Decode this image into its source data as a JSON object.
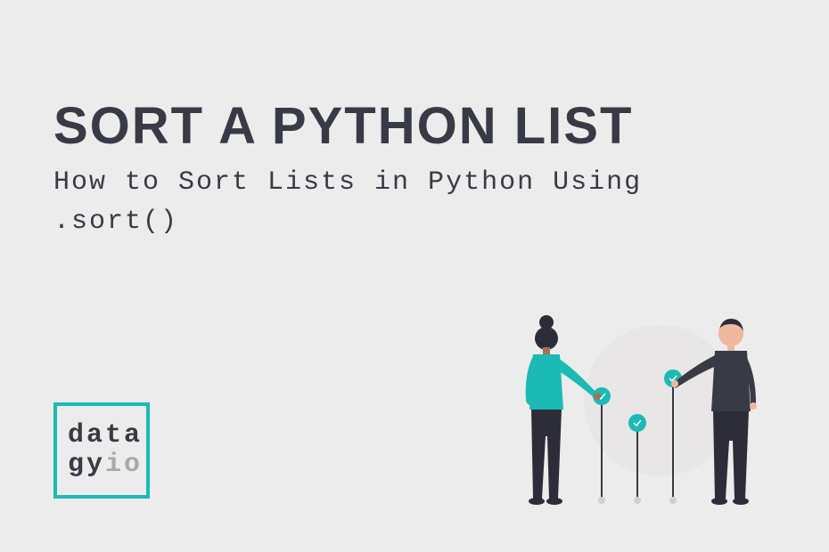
{
  "title": "SORT A PYTHON LIST",
  "subtitle": "How to Sort Lists in Python Using .sort()",
  "logo": {
    "line1": "data",
    "line2_part1": "gy",
    "line2_part2": "io"
  },
  "colors": {
    "background": "#edecec",
    "text_dark": "#383b46",
    "teal": "#1cbab4",
    "gray": "#a8a8a8"
  }
}
